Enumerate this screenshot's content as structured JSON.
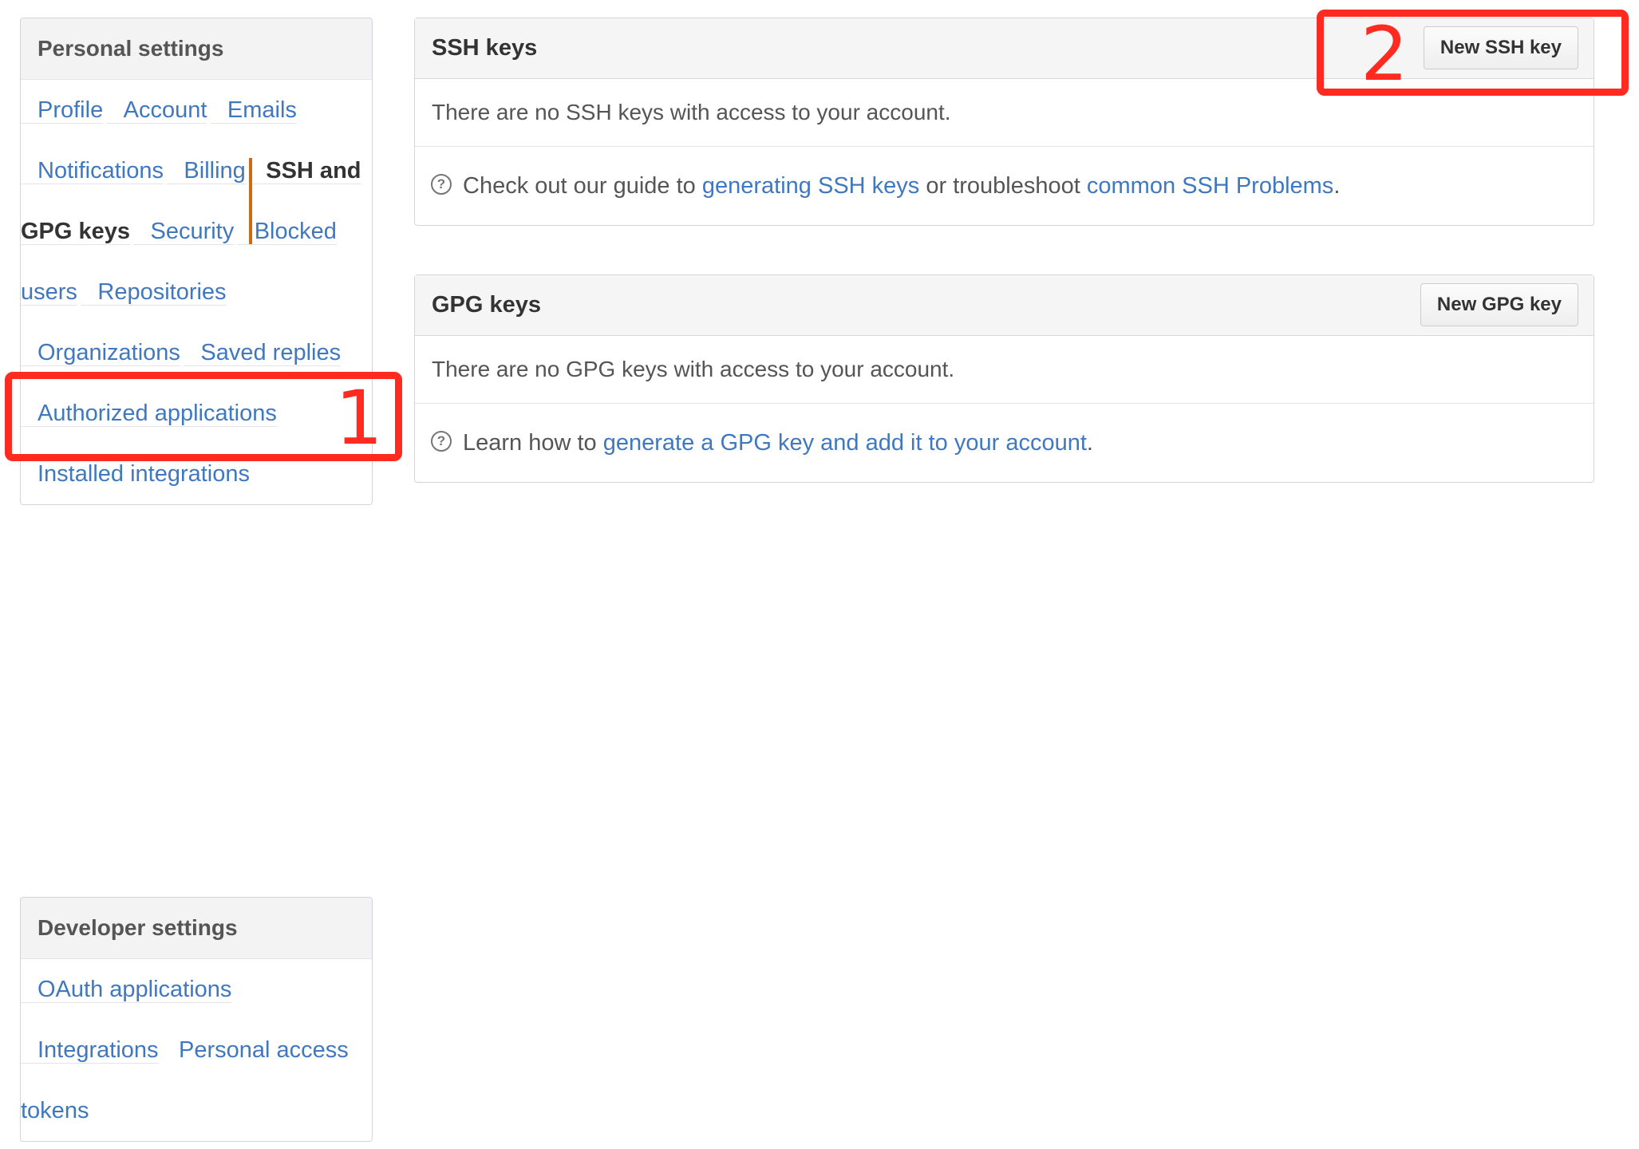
{
  "sidebar": {
    "personal_heading": "Personal settings",
    "personal_items": [
      {
        "label": "Profile",
        "selected": false
      },
      {
        "label": "Account",
        "selected": false
      },
      {
        "label": "Emails",
        "selected": false
      },
      {
        "label": "Notifications",
        "selected": false
      },
      {
        "label": "Billing",
        "selected": false
      },
      {
        "label": "SSH and GPG keys",
        "selected": true
      },
      {
        "label": "Security",
        "selected": false
      },
      {
        "label": "Blocked users",
        "selected": false
      },
      {
        "label": "Repositories",
        "selected": false
      },
      {
        "label": "Organizations",
        "selected": false
      },
      {
        "label": "Saved replies",
        "selected": false
      },
      {
        "label": "Authorized applications",
        "selected": false
      },
      {
        "label": "Installed integrations",
        "selected": false
      }
    ],
    "developer_heading": "Developer settings",
    "developer_items": [
      {
        "label": "OAuth applications"
      },
      {
        "label": "Integrations"
      },
      {
        "label": "Personal access tokens"
      }
    ]
  },
  "ssh": {
    "title": "SSH keys",
    "new_button": "New SSH key",
    "empty_text": "There are no SSH keys with access to your account.",
    "help_prefix": "Check out our guide to ",
    "help_link1": "generating SSH keys",
    "help_middle": " or troubleshoot ",
    "help_link2": "common SSH Problems",
    "help_suffix": "."
  },
  "gpg": {
    "title": "GPG keys",
    "new_button": "New GPG key",
    "empty_text": "There are no GPG keys with access to your account.",
    "help_prefix": "Learn how to ",
    "help_link": "generate a GPG key and add it to your account",
    "help_suffix": "."
  },
  "annotations": {
    "step1": "1",
    "step2": "2"
  },
  "icons": {
    "help": "question-circle-icon"
  },
  "colors": {
    "link": "#4078c0",
    "selected_indicator": "#d26911",
    "annotation": "#ff2a20"
  }
}
